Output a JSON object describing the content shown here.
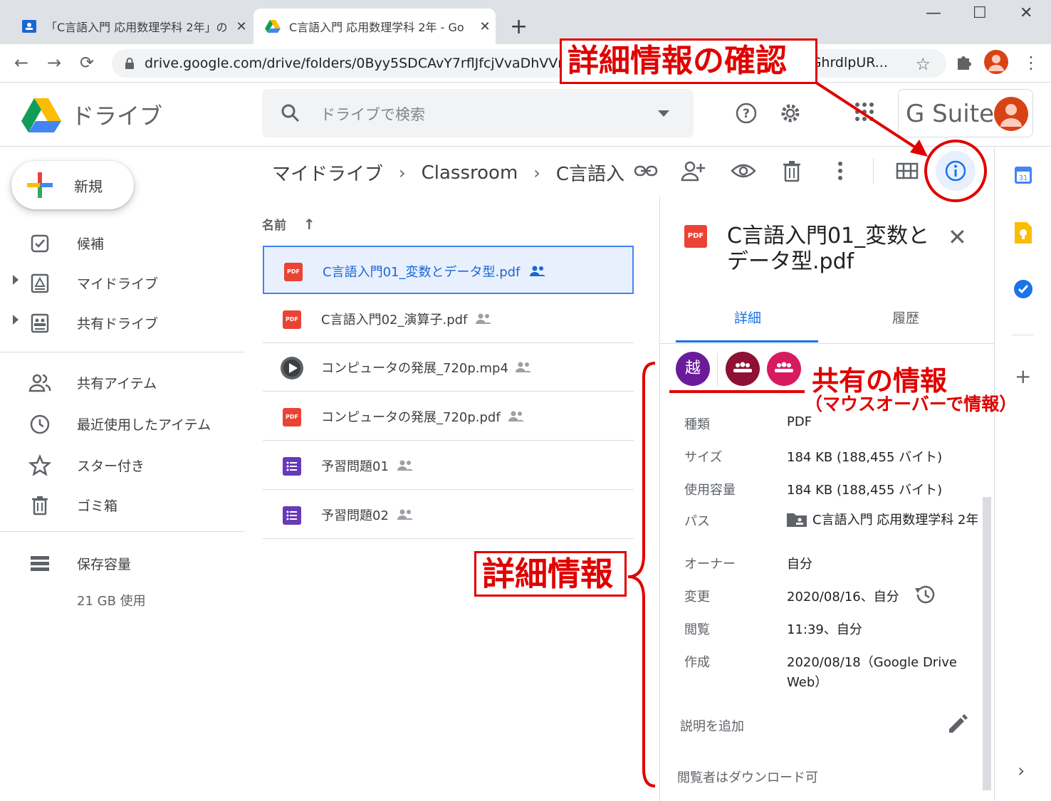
{
  "browser": {
    "tabs": [
      {
        "title": "「C言語入門 応用数理学科 2年」の",
        "close": "✕"
      },
      {
        "title": "C言語入門 応用数理学科 2年 - Go",
        "close": "✕"
      }
    ],
    "new_tab": "+",
    "url": "drive.google.com/drive/folders/0Byy5SDCAvY7rflJfcjVvaDhVVm1iOeGhrdlpUR...",
    "url_tail": "eGhrdlpUR...",
    "window_controls": {
      "minimize": "—",
      "maximize": "☐",
      "close": "✕"
    }
  },
  "drive": {
    "app_name": "ドライブ",
    "search_placeholder": "ドライブで検索",
    "gsuite_label": "G Suite",
    "new_button": "新規",
    "nav": [
      {
        "label": "候補",
        "icon": "priority-icon"
      },
      {
        "label": "マイドライブ",
        "icon": "my-drive-icon"
      },
      {
        "label": "共有ドライブ",
        "icon": "shared-drives-icon"
      },
      {
        "label": "共有アイテム",
        "icon": "shared-with-me-icon"
      },
      {
        "label": "最近使用したアイテム",
        "icon": "recent-icon"
      },
      {
        "label": "スター付き",
        "icon": "star-icon"
      },
      {
        "label": "ゴミ箱",
        "icon": "trash-icon"
      },
      {
        "label": "保存容量",
        "icon": "storage-icon"
      }
    ],
    "storage_used": "21 GB 使用",
    "breadcrumb": [
      "マイドライブ",
      "Classroom",
      "C言語入"
    ],
    "column_name": "名前",
    "sort_arrow": "↑",
    "files": [
      {
        "name": "C言語入門01_変数とデータ型.pdf",
        "type": "pdf",
        "selected": true
      },
      {
        "name": "C言語入門02_演算子.pdf",
        "type": "pdf",
        "selected": false
      },
      {
        "name": "コンピュータの発展_720p.mp4",
        "type": "video",
        "selected": false
      },
      {
        "name": "コンピュータの発展_720p.pdf",
        "type": "pdf",
        "selected": false
      },
      {
        "name": "予習問題01",
        "type": "form",
        "selected": false
      },
      {
        "name": "予習問題02",
        "type": "form",
        "selected": false
      }
    ],
    "pdf_label": "PDF",
    "details": {
      "title": "C言語入門01_変数とデータ型.pdf",
      "tabs": [
        "詳細",
        "履歴"
      ],
      "owner_avatar": "越",
      "avatar_colors": [
        "#6a1b9a",
        "#8e1035",
        "#d81b60"
      ],
      "rows": [
        {
          "label": "種類",
          "value": "PDF"
        },
        {
          "label": "サイズ",
          "value": "184 KB (188,455 バイト)"
        },
        {
          "label": "使用容量",
          "value": "184 KB (188,455 バイト)"
        },
        {
          "label": "パス",
          "value": "C言語入門 応用数理学科 2年"
        },
        {
          "label": "オーナー",
          "value": "自分"
        },
        {
          "label": "変更",
          "value": "2020/08/16、自分"
        },
        {
          "label": "閲覧",
          "value": "11:39、自分"
        },
        {
          "label": "作成",
          "value": "2020/08/18（Google Drive"
        }
      ],
      "created_cont": "Web）",
      "add_description": "説明を追加",
      "download_note": "閲覧者はダウンロード可"
    }
  },
  "annotations": {
    "detail_check": "詳細情報の確認",
    "share_info": "共有の情報",
    "share_hint": "（マウスオーバーで情報）",
    "detail_info": "詳細情報",
    "color": "#e00000"
  }
}
